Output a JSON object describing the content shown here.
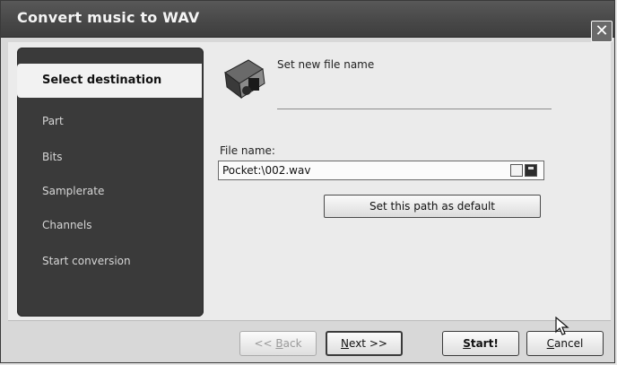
{
  "window": {
    "title": "Convert music to WAV",
    "close_label": "✕"
  },
  "sidebar": {
    "items": [
      {
        "label": "Select destination",
        "active": true
      },
      {
        "label": "Part"
      },
      {
        "label": "Bits"
      },
      {
        "label": "Samplerate"
      },
      {
        "label": "Channels"
      },
      {
        "label": "Start conversion"
      }
    ]
  },
  "page": {
    "subtitle": "Set new file name",
    "file_name_label": "File name:",
    "file_name_value": "Pocket:\\002.wav",
    "default_button": "Set this path as default"
  },
  "footer": {
    "back_prefix": "<< ",
    "back_mnemonic": "B",
    "back_rest": "ack",
    "next_mnemonic": "N",
    "next_rest": "ext >>",
    "start_mnemonic": "S",
    "start_rest": "tart!",
    "cancel_mnemonic": "C",
    "cancel_rest": "ancel"
  },
  "icons": {
    "header": "music-file-icon",
    "browse": "browse-icon",
    "save": "floppy-disk-icon",
    "cursor": "mouse-pointer-icon"
  }
}
